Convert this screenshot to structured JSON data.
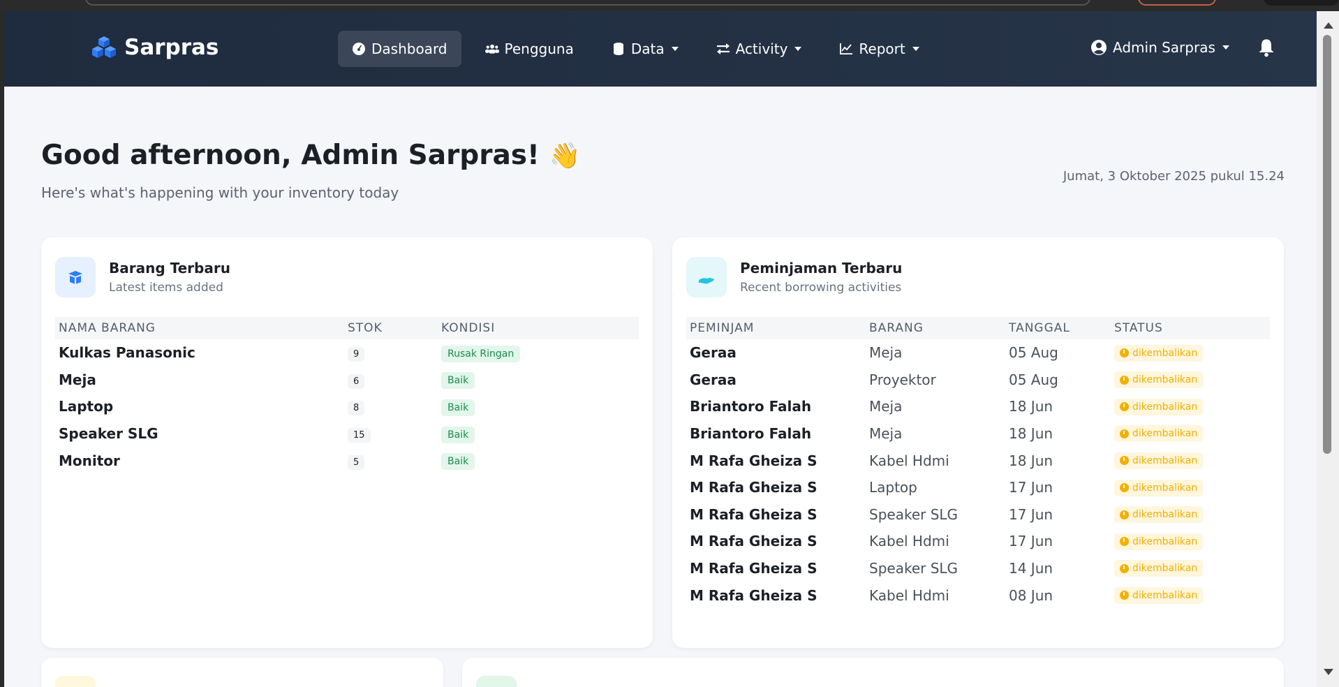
{
  "brand": {
    "name": "Sarpras"
  },
  "nav": {
    "items": [
      {
        "label": "Dashboard",
        "icon": "dashboard-icon"
      },
      {
        "label": "Pengguna",
        "icon": "users-icon"
      },
      {
        "label": "Data",
        "icon": "database-icon"
      },
      {
        "label": "Activity",
        "icon": "exchange-icon"
      },
      {
        "label": "Report",
        "icon": "chart-icon"
      }
    ],
    "user": "Admin Sarpras"
  },
  "greeting": {
    "title": "Good afternoon, Admin Sarpras!",
    "emoji": "👋",
    "subtitle": "Here's what's happening with your inventory today",
    "datetime": "Jumat, 3 Oktober 2025 pukul 15.24"
  },
  "barang": {
    "title": "Barang Terbaru",
    "subtitle": "Latest items added",
    "headers": [
      "NAMA BARANG",
      "STOK",
      "KONDISI"
    ],
    "rows": [
      {
        "nama": "Kulkas Panasonic",
        "stok": "9",
        "kondisi": "Rusak Ringan"
      },
      {
        "nama": "Meja",
        "stok": "6",
        "kondisi": "Baik"
      },
      {
        "nama": "Laptop",
        "stok": "8",
        "kondisi": "Baik"
      },
      {
        "nama": "Speaker SLG",
        "stok": "15",
        "kondisi": "Baik"
      },
      {
        "nama": "Monitor",
        "stok": "5",
        "kondisi": "Baik"
      }
    ]
  },
  "peminjaman": {
    "title": "Peminjaman Terbaru",
    "subtitle": "Recent borrowing activities",
    "headers": [
      "PEMINJAM",
      "BARANG",
      "TANGGAL",
      "STATUS"
    ],
    "rows": [
      {
        "peminjam": "Geraa",
        "barang": "Meja",
        "tanggal": "05 Aug",
        "status": "dikembalikan"
      },
      {
        "peminjam": "Geraa",
        "barang": "Proyektor",
        "tanggal": "05 Aug",
        "status": "dikembalikan"
      },
      {
        "peminjam": "Briantoro Falah",
        "barang": "Meja",
        "tanggal": "18 Jun",
        "status": "dikembalikan"
      },
      {
        "peminjam": "Briantoro Falah",
        "barang": "Meja",
        "tanggal": "18 Jun",
        "status": "dikembalikan"
      },
      {
        "peminjam": "M Rafa Gheiza S",
        "barang": "Kabel Hdmi",
        "tanggal": "18 Jun",
        "status": "dikembalikan"
      },
      {
        "peminjam": "M Rafa Gheiza S",
        "barang": "Laptop",
        "tanggal": "17 Jun",
        "status": "dikembalikan"
      },
      {
        "peminjam": "M Rafa Gheiza S",
        "barang": "Speaker SLG",
        "tanggal": "17 Jun",
        "status": "dikembalikan"
      },
      {
        "peminjam": "M Rafa Gheiza S",
        "barang": "Kabel Hdmi",
        "tanggal": "17 Jun",
        "status": "dikembalikan"
      },
      {
        "peminjam": "M Rafa Gheiza S",
        "barang": "Speaker SLG",
        "tanggal": "14 Jun",
        "status": "dikembalikan"
      },
      {
        "peminjam": "M Rafa Gheiza S",
        "barang": "Kabel Hdmi",
        "tanggal": "08 Jun",
        "status": "dikembalikan"
      }
    ]
  },
  "colors": {
    "navbar": "#1f2b3e",
    "brand_icon": "#2f7df6",
    "accent_cyan": "#22c4de",
    "status_yellow": "#f2b000",
    "badge_green": "#1e8a4e"
  }
}
